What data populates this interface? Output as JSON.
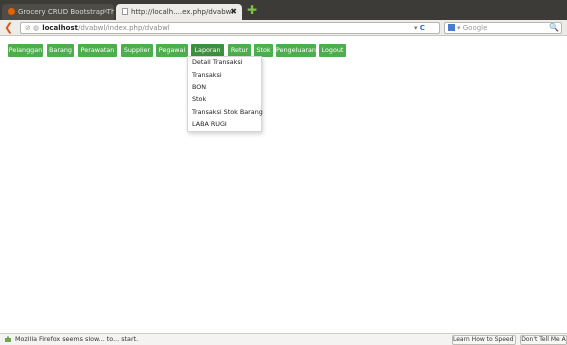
{
  "browser": {
    "tabs": [
      {
        "label": "Grocery CRUD Bootstrap Th...",
        "close": "✕"
      },
      {
        "label": "http://localh....ex.php/dvabwl",
        "close": "✖"
      }
    ],
    "new_tab": "✚",
    "url": {
      "host": "localhost",
      "path": "/dvabwl/index.php/dvabwl"
    },
    "search_placeholder": "Google"
  },
  "menu": {
    "items": [
      {
        "label": "Pelanggan"
      },
      {
        "label": "Barang"
      },
      {
        "label": "Perawatan"
      },
      {
        "label": "Supplier"
      },
      {
        "label": "Pegawai"
      },
      {
        "label": "Laporan"
      },
      {
        "label": "Retur"
      },
      {
        "label": "Stok"
      },
      {
        "label": "Pengeluaran"
      },
      {
        "label": "Logout"
      }
    ],
    "open_index": 5,
    "accent": "#4cae4c"
  },
  "dropdown": {
    "items": [
      {
        "label": "Detail Transaksi"
      },
      {
        "label": "Transaksi"
      },
      {
        "label": "BON"
      },
      {
        "label": "Stok"
      },
      {
        "label": "Transaksi Stok Barang"
      },
      {
        "label": "LABA RUGI"
      }
    ]
  },
  "statusbar": {
    "notification": "Mozilla Firefox seems slow... to... start.",
    "buttons": [
      "Learn How to Speed It Up",
      "Don't Tell Me A"
    ]
  }
}
